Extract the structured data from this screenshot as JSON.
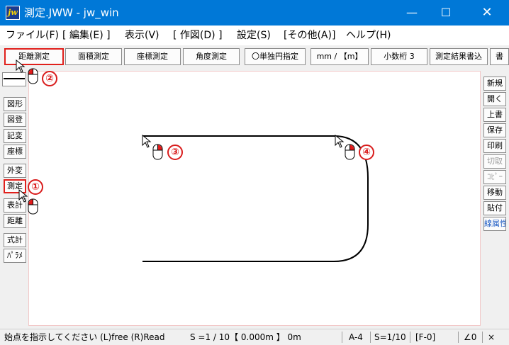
{
  "window": {
    "icon_text": "jw",
    "title": "測定.JWW - jw_win",
    "minimize": "—",
    "maximize": "☐",
    "close": "✕"
  },
  "menu": [
    "ファイル(F)",
    "[ 編集(E) ]",
    "表示(V)",
    "[ 作図(D) ]",
    "設定(S)",
    "[その他(A)]",
    "ヘルプ(H)"
  ],
  "toolbar": [
    "距離測定",
    "面積測定",
    "座標測定",
    "角度測定",
    "〇単独円指定",
    "mm / 【m】",
    "小数桁 3",
    "測定結果書込",
    "書"
  ],
  "left_tools": [
    "図形",
    "図登",
    "記変",
    "座標",
    "外変",
    "測定",
    "表計",
    "距離",
    "式計",
    "ﾊﾟﾗﾒ"
  ],
  "right_tools": [
    "新規",
    "開く",
    "上書",
    "保存",
    "印刷",
    "切取",
    "ｺﾋﾟｰ",
    "移動",
    "貼付",
    "線属性"
  ],
  "annotations": [
    "①",
    "②",
    "③",
    "④"
  ],
  "status": {
    "hint": "始点を指示してください (L)free (R)Read",
    "scale": "S =1 / 10【 0.000m 】  0m",
    "paper": "A-4",
    "scale_short": "S=1/10",
    "layer": "[F-0]",
    "angle": "∠0",
    "x_mark": "×"
  },
  "colors": {
    "titlebar": "#0078d7",
    "highlight": "#e0201c",
    "annotation": "#d91c1c"
  }
}
